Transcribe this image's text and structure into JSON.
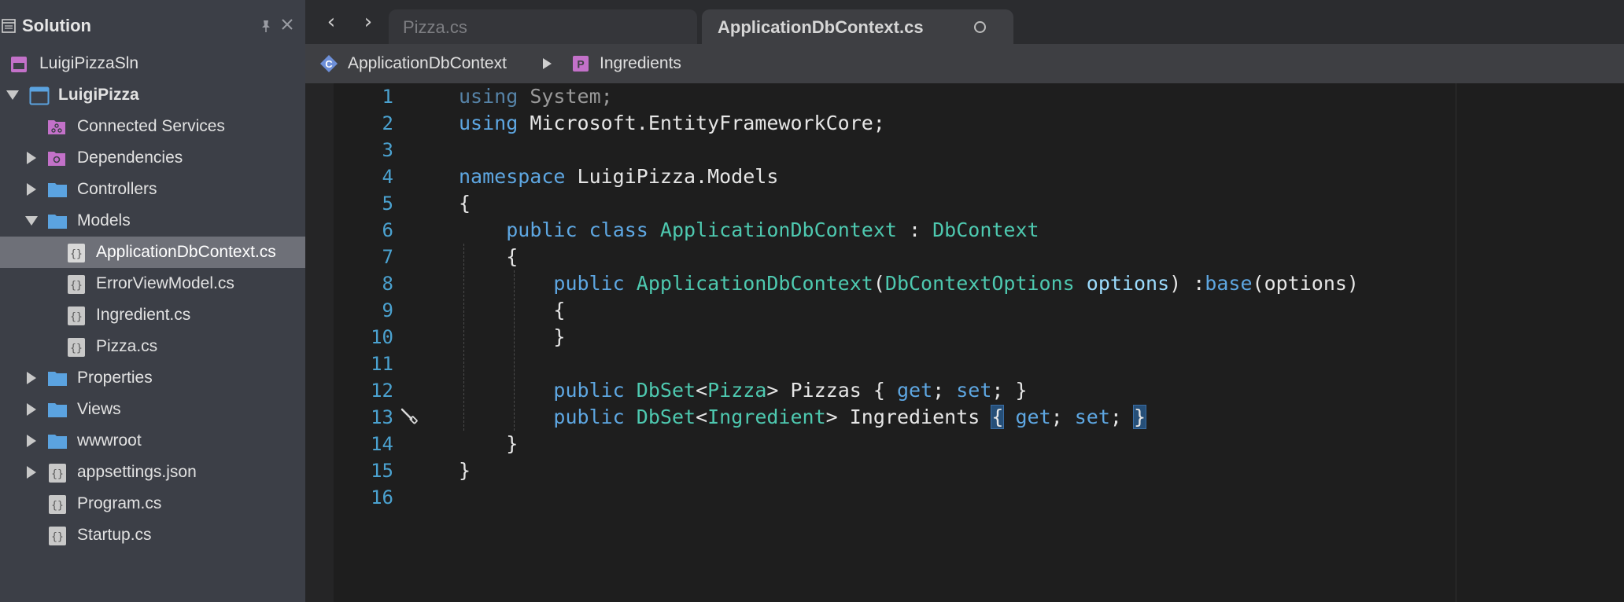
{
  "sidebar": {
    "title": "Solution",
    "items": [
      {
        "label": "LuigiPizzaSln",
        "icon": "solution-icon"
      },
      {
        "label": "LuigiPizza",
        "icon": "project-icon",
        "expanded": true
      },
      {
        "label": "Connected Services",
        "icon": "connected-services-icon"
      },
      {
        "label": "Dependencies",
        "icon": "dependencies-icon"
      },
      {
        "label": "Controllers",
        "icon": "folder-icon"
      },
      {
        "label": "Models",
        "icon": "folder-icon",
        "expanded": true
      },
      {
        "label": "ApplicationDbContext.cs",
        "icon": "csharp-file-icon",
        "selected": true
      },
      {
        "label": "ErrorViewModel.cs",
        "icon": "csharp-file-icon"
      },
      {
        "label": "Ingredient.cs",
        "icon": "csharp-file-icon"
      },
      {
        "label": "Pizza.cs",
        "icon": "csharp-file-icon"
      },
      {
        "label": "Properties",
        "icon": "folder-icon"
      },
      {
        "label": "Views",
        "icon": "folder-icon"
      },
      {
        "label": "wwwroot",
        "icon": "folder-icon"
      },
      {
        "label": "appsettings.json",
        "icon": "json-file-icon"
      },
      {
        "label": "Program.cs",
        "icon": "csharp-file-icon"
      },
      {
        "label": "Startup.cs",
        "icon": "csharp-file-icon"
      }
    ]
  },
  "tabs": [
    {
      "label": "Pizza.cs",
      "active": false
    },
    {
      "label": "ApplicationDbContext.cs",
      "active": true
    }
  ],
  "breadcrumb": {
    "class_label": "ApplicationDbContext",
    "class_icon_letter": "C",
    "member_label": "Ingredients",
    "member_icon_letter": "P"
  },
  "editor": {
    "line_numbers": [
      "1",
      "2",
      "3",
      "4",
      "5",
      "6",
      "7",
      "8",
      "9",
      "10",
      "11",
      "12",
      "13",
      "14",
      "15",
      "16"
    ],
    "lines": [
      "using System;",
      "using Microsoft.EntityFrameworkCore;",
      "",
      "namespace LuigiPizza.Models",
      "{",
      "    public class ApplicationDbContext : DbContext",
      "    {",
      "        public ApplicationDbContext(DbContextOptions options) :base(options)",
      "        {",
      "        }",
      "",
      "        public DbSet<Pizza> Pizzas { get; set; }",
      "        public DbSet<Ingredient> Ingredients { get; set; }",
      "    }",
      "}",
      ""
    ]
  },
  "colors": {
    "keyword": "#5ea7e2",
    "type": "#4ec9b0",
    "line_number": "#4ba2d0",
    "sidebar_bg": "#3c3f47",
    "selection_bg": "#6e7078",
    "folder": "#5ba3e0",
    "purple_icon": "#c371c9"
  }
}
